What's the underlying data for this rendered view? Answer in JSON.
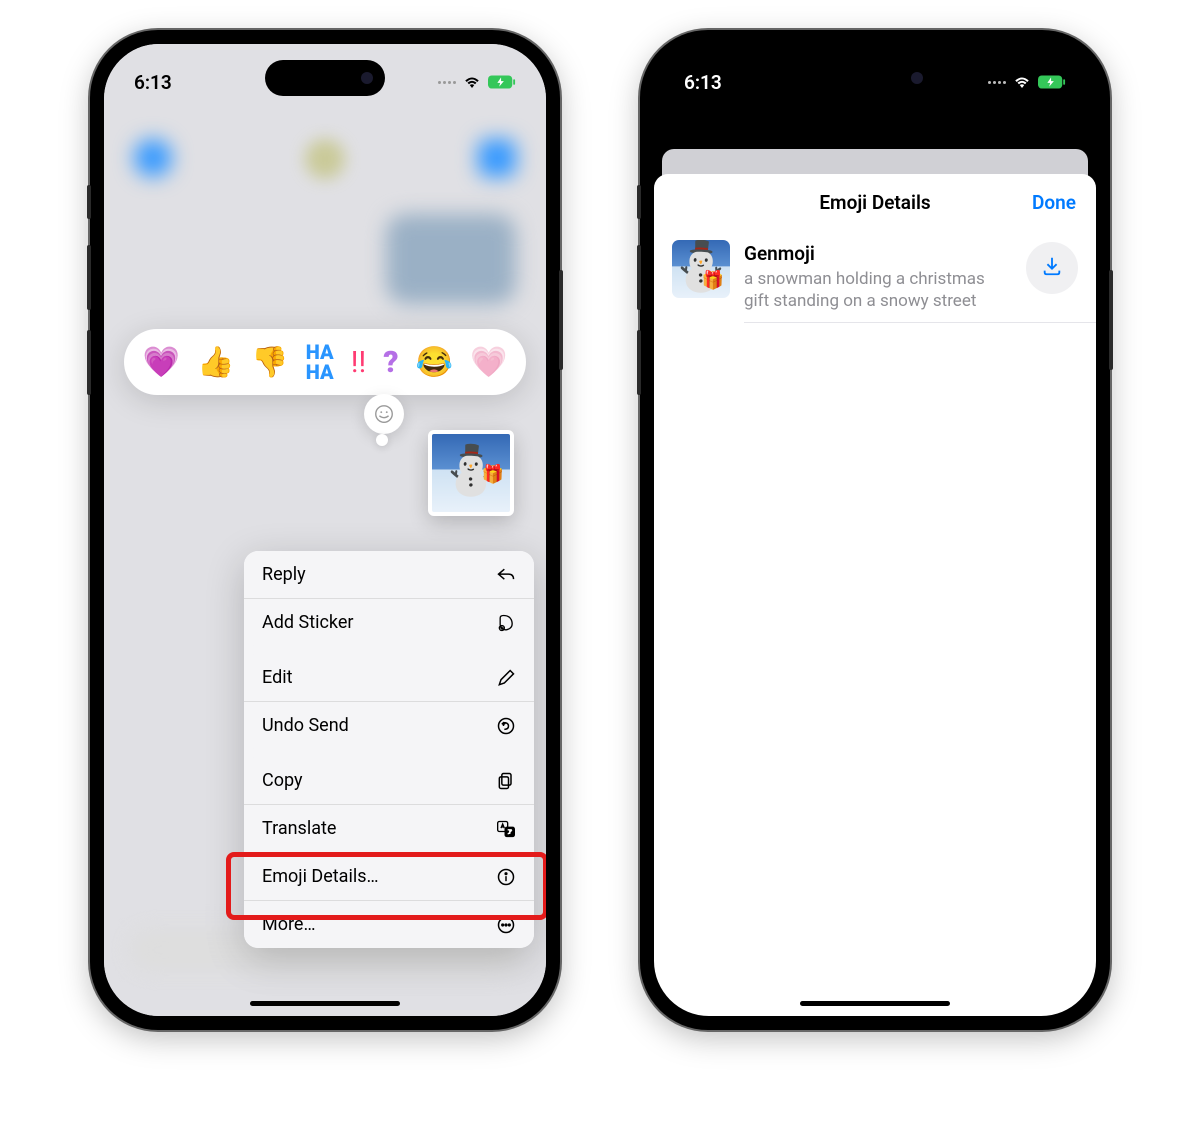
{
  "status": {
    "time": "6:13"
  },
  "reactions": {
    "heart": "❤️",
    "thumbs_up": "👍",
    "thumbs_down": "👎",
    "haha": "😂",
    "emphasis": "‼️",
    "question": "❓",
    "laugh": "😂"
  },
  "context_menu": {
    "reply": "Reply",
    "add_sticker": "Add Sticker",
    "edit": "Edit",
    "undo_send": "Undo Send",
    "copy": "Copy",
    "translate": "Translate",
    "emoji_details": "Emoji Details…",
    "more": "More…"
  },
  "details_sheet": {
    "title": "Emoji Details",
    "done": "Done",
    "item_name": "Genmoji",
    "item_desc": "a snowman holding a christmas gift standing on a snowy street"
  }
}
